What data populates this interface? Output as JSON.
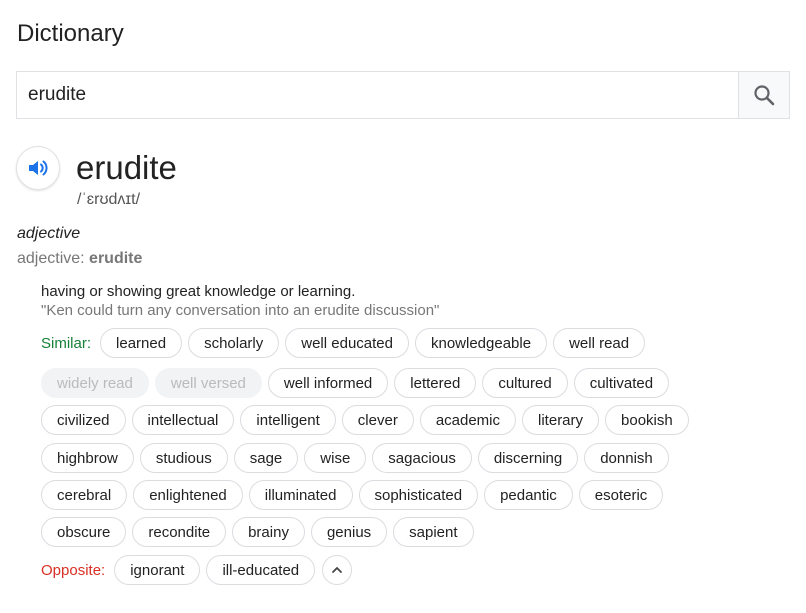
{
  "page_title": "Dictionary",
  "search": {
    "value": "erudite"
  },
  "entry": {
    "word": "erudite",
    "phonetic": "/ˈɛrʊdʌɪt/",
    "part_of_speech": "adjective",
    "pos_prefix": "adjective: ",
    "pos_word": "erudite",
    "definition": "having or showing great knowledge or learning.",
    "example": "\"Ken could turn any conversation into an erudite discussion\""
  },
  "similar": {
    "label": "Similar:",
    "rows": [
      [
        {
          "text": "learned",
          "faded": false
        },
        {
          "text": "scholarly",
          "faded": false
        },
        {
          "text": "well educated",
          "faded": false
        },
        {
          "text": "knowledgeable",
          "faded": false
        },
        {
          "text": "well read",
          "faded": false
        }
      ],
      [
        {
          "text": "widely read",
          "faded": true
        },
        {
          "text": "well versed",
          "faded": true
        },
        {
          "text": "well informed",
          "faded": false
        },
        {
          "text": "lettered",
          "faded": false
        },
        {
          "text": "cultured",
          "faded": false
        },
        {
          "text": "cultivated",
          "faded": false
        }
      ],
      [
        {
          "text": "civilized",
          "faded": false
        },
        {
          "text": "intellectual",
          "faded": false
        },
        {
          "text": "intelligent",
          "faded": false
        },
        {
          "text": "clever",
          "faded": false
        },
        {
          "text": "academic",
          "faded": false
        },
        {
          "text": "literary",
          "faded": false
        },
        {
          "text": "bookish",
          "faded": false
        }
      ],
      [
        {
          "text": "highbrow",
          "faded": false
        },
        {
          "text": "studious",
          "faded": false
        },
        {
          "text": "sage",
          "faded": false
        },
        {
          "text": "wise",
          "faded": false
        },
        {
          "text": "sagacious",
          "faded": false
        },
        {
          "text": "discerning",
          "faded": false
        },
        {
          "text": "donnish",
          "faded": false
        }
      ],
      [
        {
          "text": "cerebral",
          "faded": false
        },
        {
          "text": "enlightened",
          "faded": false
        },
        {
          "text": "illuminated",
          "faded": false
        },
        {
          "text": "sophisticated",
          "faded": false
        },
        {
          "text": "pedantic",
          "faded": false
        },
        {
          "text": "esoteric",
          "faded": false
        }
      ],
      [
        {
          "text": "obscure",
          "faded": false
        },
        {
          "text": "recondite",
          "faded": false
        },
        {
          "text": "brainy",
          "faded": false
        },
        {
          "text": "genius",
          "faded": false
        },
        {
          "text": "sapient",
          "faded": false
        }
      ]
    ]
  },
  "opposite": {
    "label": "Opposite:",
    "items": [
      "ignorant",
      "ill-educated"
    ]
  },
  "icons": {
    "search": "search-icon",
    "speaker": "speaker-icon",
    "collapse": "chevron-up-icon"
  },
  "colors": {
    "similar_label": "#188038",
    "opposite_label": "#d93025",
    "speaker_blue": "#1a73e8"
  }
}
